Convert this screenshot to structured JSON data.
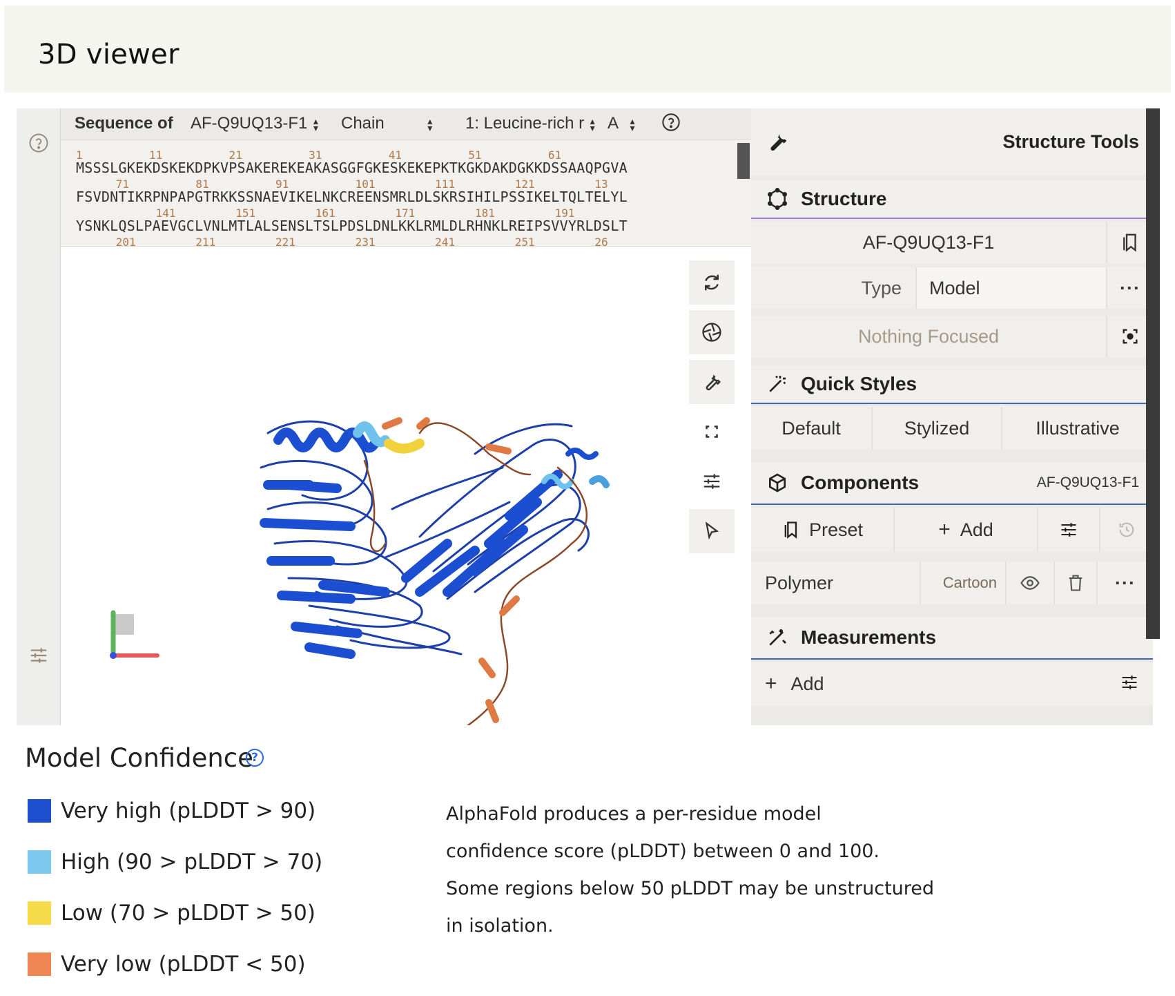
{
  "header": {
    "title": "3D viewer"
  },
  "sequence": {
    "label": "Sequence of",
    "entry": "AF-Q9UQ13-F1",
    "chain_label": "Chain",
    "entity": "1: Leucine-rich r",
    "chain": "A",
    "lines": [
      {
        "numbers": "1          11          21          31          41          51          61",
        "text": "MSSSLGKEKDSKEKDPKVPSAKEREKEAKASGGFGKESKEKEPKTKGKDAKDGKKDSSAAQPGVA"
      },
      {
        "numbers": "      71          81          91          101         111         121         13",
        "text": "FSVDNTIKRPNPAPGTRKKSSNAEVIKELNKCREENSMRLDLSKRSIHILPSSIKELTQLTELYL"
      },
      {
        "numbers": "            141         151         161         171         181         191",
        "text": "YSNKLQSLPAEVGCLVNLMTLALSENSLTSLPDSLDNLKKLRMLDLRHNKLREIPSVVYRLDSLT"
      },
      {
        "numbers": "      201         211         221         231         241         251         26",
        "text": ""
      }
    ]
  },
  "structure_tools": {
    "title": "Structure Tools",
    "structure_section": "Structure",
    "structure_name": "AF-Q9UQ13-F1",
    "type_label": "Type",
    "type_value": "Model",
    "focus_text": "Nothing Focused",
    "quick_styles_section": "Quick Styles",
    "styles": [
      "Default",
      "Stylized",
      "Illustrative"
    ],
    "components_section": "Components",
    "components_entry": "AF-Q9UQ13-F1",
    "preset_label": "Preset",
    "add_label": "Add",
    "polymer_label": "Polymer",
    "polymer_repr": "Cartoon",
    "measurements_section": "Measurements",
    "measurements_add": "Add"
  },
  "legend": {
    "title": "Model Confidence",
    "items": [
      {
        "label": "Very high (pLDDT > 90)",
        "color": "#1f4fd1"
      },
      {
        "label": "High (90 > pLDDT > 70)",
        "color": "#7cc8ee"
      },
      {
        "label": "Low (70 > pLDDT > 50)",
        "color": "#f6dc4a"
      },
      {
        "label": "Very low (pLDDT < 50)",
        "color": "#ee8552"
      }
    ],
    "description_lines": [
      "AlphaFold produces a per-residue model",
      "confidence score (pLDDT) between 0 and 100.",
      "Some regions below 50 pLDDT may be unstructured",
      "in isolation."
    ]
  }
}
